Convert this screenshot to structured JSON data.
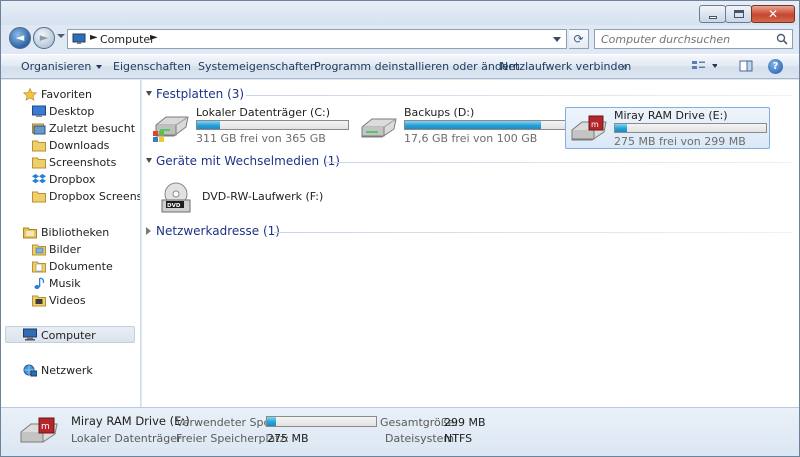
{
  "window": {
    "controls": {
      "minimize_icon": "minimize-icon",
      "maximize_icon": "maximize-icon",
      "close_glyph": "✕"
    }
  },
  "address": {
    "crumbs": [
      "Computer"
    ],
    "separator": "►",
    "refresh_glyph": "⟳",
    "back_glyph": "◄",
    "forward_glyph": "►"
  },
  "search": {
    "placeholder": "Computer durchsuchen"
  },
  "toolbar": {
    "organize": "Organisieren",
    "properties": "Eigenschaften",
    "system_properties": "Systemeigenschaften",
    "uninstall": "Programm deinstallieren oder ändern",
    "map_drive": "Netzlaufwerk verbinden",
    "more": "»",
    "help": "?"
  },
  "sidebar": {
    "favorites": {
      "label": "Favoriten",
      "items": [
        {
          "label": "Desktop",
          "icon": "desktop-icon"
        },
        {
          "label": "Zuletzt besucht",
          "icon": "recent-places-icon"
        },
        {
          "label": "Downloads",
          "icon": "folder-icon"
        },
        {
          "label": "Screenshots",
          "icon": "folder-icon"
        },
        {
          "label": "Dropbox",
          "icon": "dropbox-icon"
        },
        {
          "label": "Dropbox Screens",
          "icon": "folder-icon"
        }
      ]
    },
    "libraries": {
      "label": "Bibliotheken",
      "items": [
        {
          "label": "Bilder",
          "icon": "pictures-icon"
        },
        {
          "label": "Dokumente",
          "icon": "documents-icon"
        },
        {
          "label": "Musik",
          "icon": "music-icon"
        },
        {
          "label": "Videos",
          "icon": "videos-icon"
        }
      ]
    },
    "computer": {
      "label": "Computer"
    },
    "network": {
      "label": "Netzwerk"
    }
  },
  "content": {
    "sections": {
      "hard_disks": {
        "title": "Festplatten (3)"
      },
      "removable": {
        "title": "Geräte mit Wechselmedien (1)"
      },
      "network": {
        "title": "Netzwerkadresse (1)"
      }
    },
    "drives": [
      {
        "name": "Lokaler Datenträger (C:)",
        "free": "311 GB frei von 365 GB",
        "used_fraction": 0.15
      },
      {
        "name": "Backups (D:)",
        "free": "17,6 GB frei von 100 GB",
        "used_fraction": 0.82
      },
      {
        "name": "Miray RAM Drive (E:)",
        "free": "275 MB frei von 299 MB",
        "used_fraction": 0.08
      }
    ],
    "removable_devices": [
      {
        "name": "DVD-RW-Laufwerk (F:)",
        "badge": "DVD"
      }
    ]
  },
  "details": {
    "name": "Miray RAM Drive (E:)",
    "type": "Lokaler Datenträger",
    "used_label": "Verwendeter Speic...",
    "used_fraction": 0.08,
    "free_label": "Freier Speicherplatz:",
    "free_value": "275 MB",
    "total_label": "Gesamtgröße:",
    "total_value": "299 MB",
    "fs_label": "Dateisystem:",
    "fs_value": "NTFS"
  },
  "colors": {
    "accent": "#1e3287",
    "bar_fill": "#27a0d8",
    "selection": "#dbe8f7"
  }
}
